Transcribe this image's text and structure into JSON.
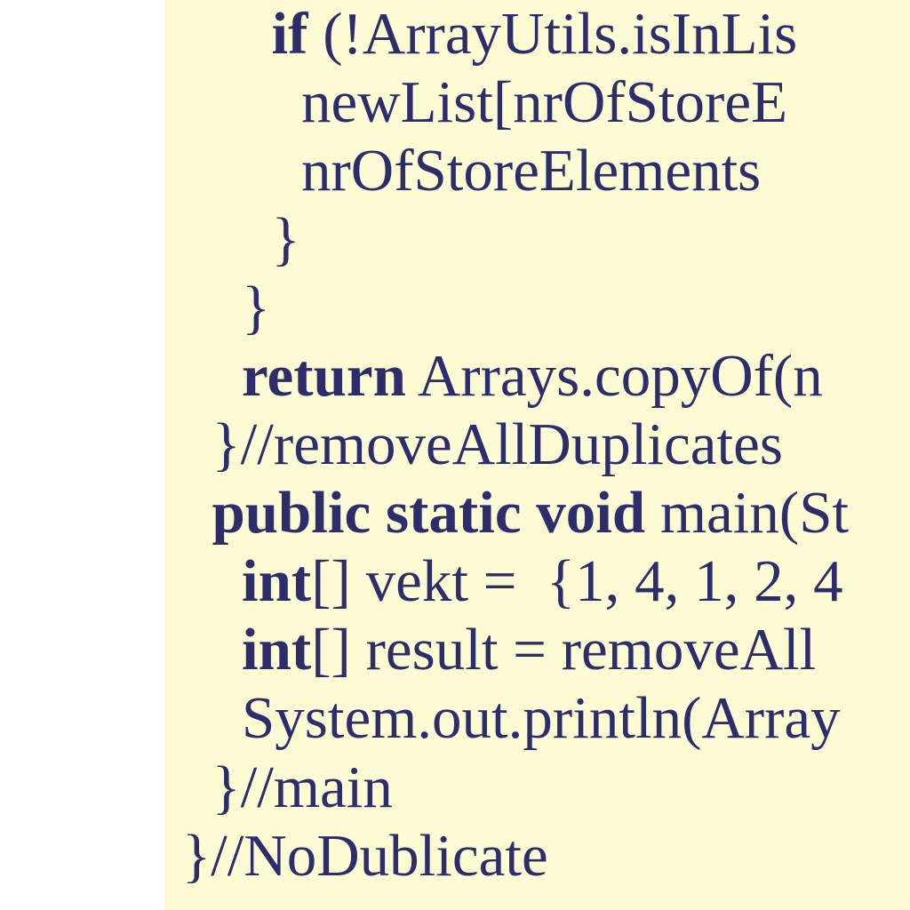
{
  "code": {
    "lines": [
      {
        "indent": "      ",
        "kw": "if",
        "rest": " (!ArrayUtils.isInLis"
      },
      {
        "indent": "        ",
        "kw": "",
        "rest": "newList[nrOfStoreE"
      },
      {
        "indent": "        ",
        "kw": "",
        "rest": "nrOfStoreElements"
      },
      {
        "indent": "      ",
        "kw": "",
        "rest": "}"
      },
      {
        "indent": "    ",
        "kw": "",
        "rest": "}"
      },
      {
        "indent": "    ",
        "kw": "return",
        "rest": " Arrays.copyOf(n"
      },
      {
        "indent": "  ",
        "kw": "",
        "rest": "}//removeAllDuplicates"
      },
      {
        "indent": "",
        "kw": "",
        "rest": ""
      },
      {
        "indent": "  ",
        "kw": "public static void",
        "rest": " main(St"
      },
      {
        "indent": "    ",
        "kw": "int",
        "rest": "[] vekt =  {1, 4, 1, 2, 4"
      },
      {
        "indent": "    ",
        "kw": "int",
        "rest": "[] result = removeAll"
      },
      {
        "indent": "    ",
        "kw": "",
        "rest": "System.out.println(Array"
      },
      {
        "indent": "  ",
        "kw": "",
        "rest": "}//main"
      },
      {
        "indent": "",
        "kw": "",
        "rest": "}//NoDublicate"
      }
    ]
  }
}
